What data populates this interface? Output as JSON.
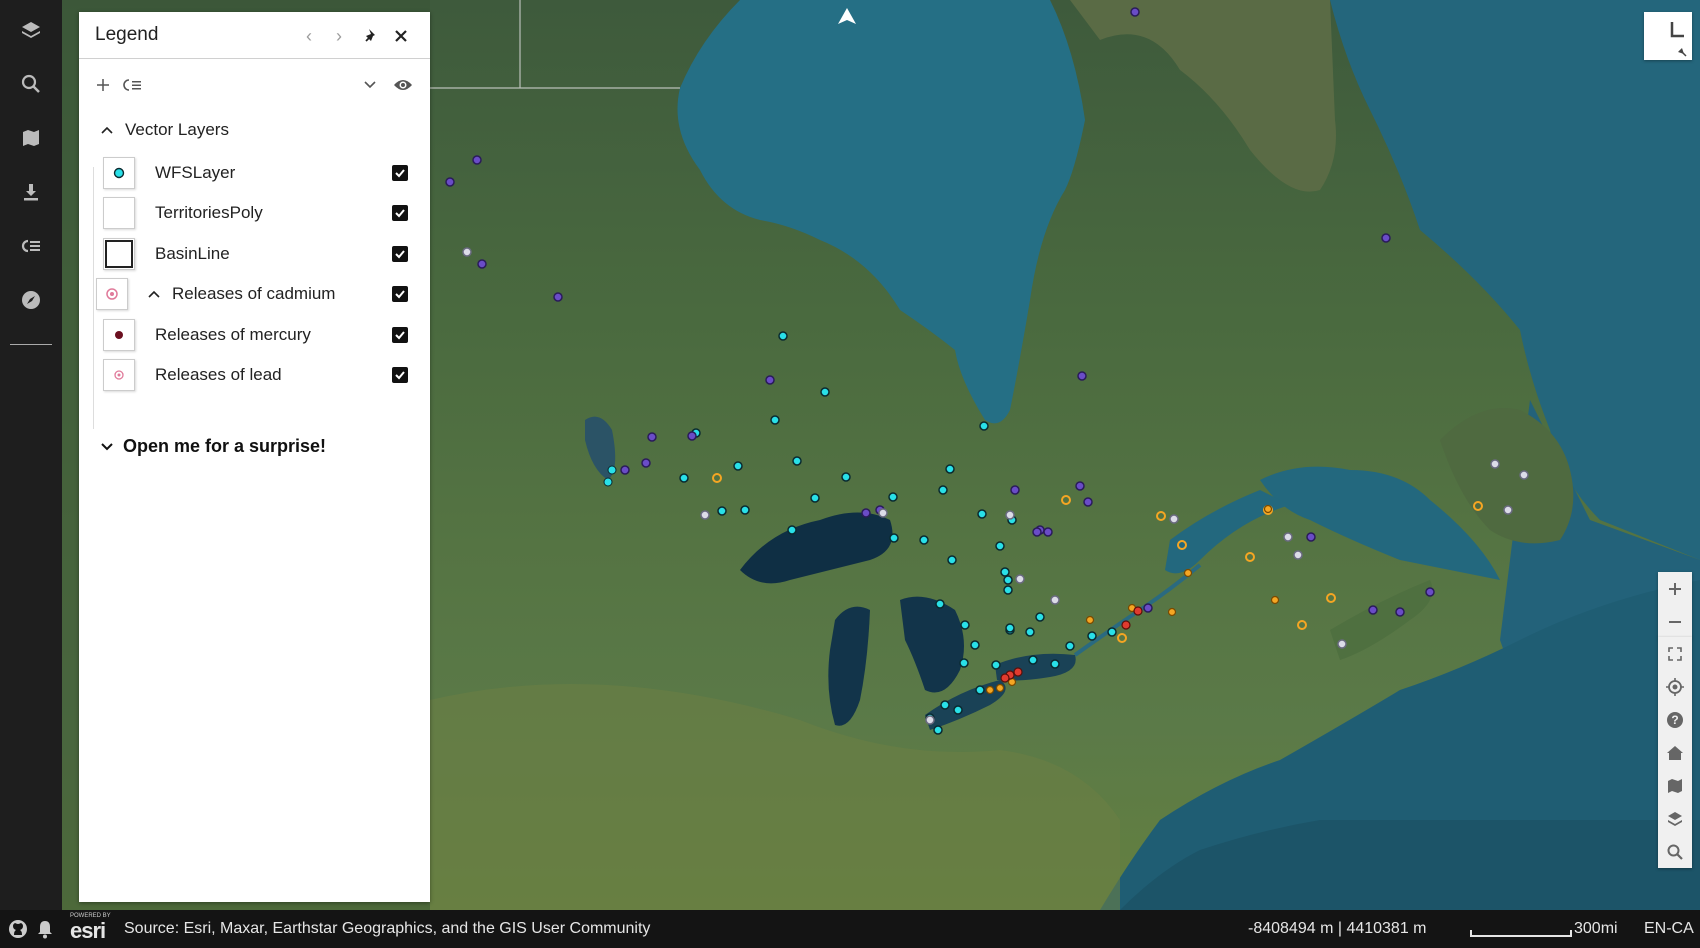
{
  "legend": {
    "title": "Legend",
    "group_label": "Vector Layers",
    "layers": [
      {
        "label": "WFSLayer",
        "checked": true,
        "symbol": "cyan-dot"
      },
      {
        "label": "TerritoriesPoly",
        "checked": true,
        "symbol": "empty-square"
      },
      {
        "label": "BasinLine",
        "checked": true,
        "symbol": "outlined-square"
      },
      {
        "label": "Releases of cadmium",
        "checked": true,
        "symbol": "pink-ring"
      },
      {
        "label": "Releases of mercury",
        "checked": true,
        "symbol": "dark-red-dot"
      },
      {
        "label": "Releases of lead",
        "checked": true,
        "symbol": "pink-ring-small"
      }
    ],
    "surprise_label": "Open me for a surprise!"
  },
  "footer": {
    "attribution": "Source: Esri, Maxar, Earthstar Geographics, and the GIS User Community",
    "coordinates": "-8408494 m | 4410381 m",
    "scale": "300mi",
    "language": "EN-CA",
    "esri_logo": "esri",
    "esri_powered": "POWERED BY"
  },
  "colors": {
    "water": "#256f85",
    "land": "#4a6a3f",
    "point_cyan": "#29e0e8",
    "point_purple": "#6a4cc7",
    "point_orange": "#f5a623",
    "point_red": "#e03b2f",
    "point_white": "#dcdce8"
  },
  "icons": {
    "appbar": [
      "layers-icon",
      "search-icon",
      "map-icon",
      "download-icon",
      "legend-icon",
      "compass-icon"
    ],
    "right_tools": [
      "zoom-in-icon",
      "zoom-out-icon",
      "fullscreen-icon",
      "locate-icon",
      "help-icon",
      "home-icon",
      "basemap-icon",
      "layers-icon",
      "search-icon"
    ]
  }
}
